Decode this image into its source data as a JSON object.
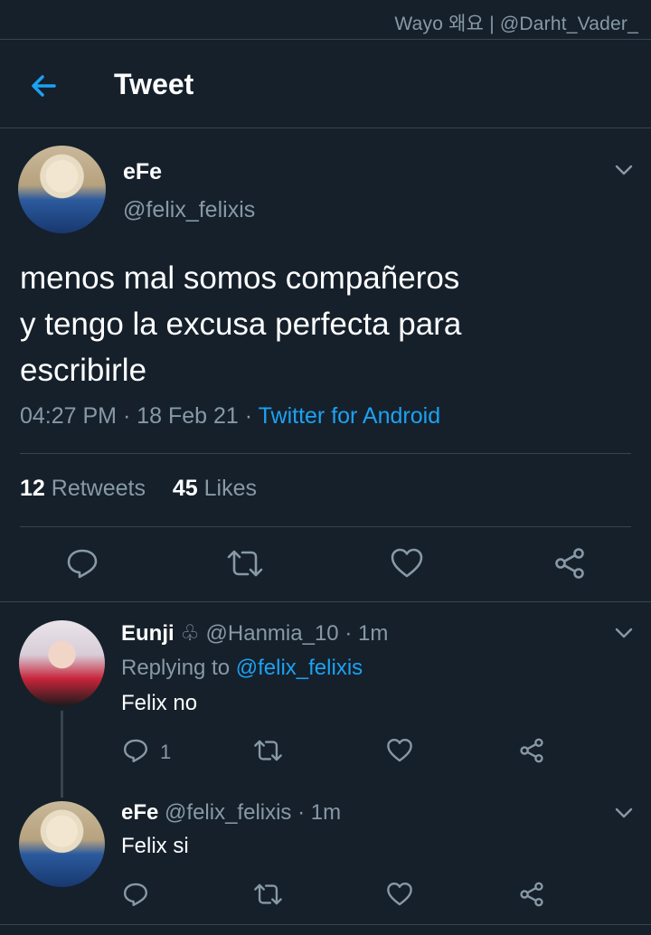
{
  "watermark": "Wayo 왜요 | @Darht_Vader_",
  "header": {
    "title": "Tweet",
    "back_icon": "arrow-left-icon"
  },
  "tweet": {
    "author_name": "eFe",
    "author_handle": "@felix_felixis",
    "text_lines": [
      "menos mal somos compañeros",
      "y tengo la excusa perfecta para",
      "escribirle"
    ],
    "time": "04:27 PM",
    "date": "18 Feb 21",
    "sep": "·",
    "source": "Twitter for Android",
    "retweets_count": "12",
    "retweets_label": "Retweets",
    "likes_count": "45",
    "likes_label": "Likes"
  },
  "replies": [
    {
      "name": "Eunji",
      "badge": "♧",
      "handle": "@Hanmia_10",
      "sep": "·",
      "time": "1m",
      "replying_label": "Replying to",
      "replying_to": "@felix_felixis",
      "text": "Felix no",
      "reply_count": "1"
    },
    {
      "name": "eFe",
      "handle": "@felix_felixis",
      "sep": "·",
      "time": "1m",
      "text": "Felix si"
    }
  ],
  "colors": {
    "background": "#15202b",
    "accent": "#1da1f2",
    "muted": "#8899a6",
    "divider": "#38444d"
  }
}
